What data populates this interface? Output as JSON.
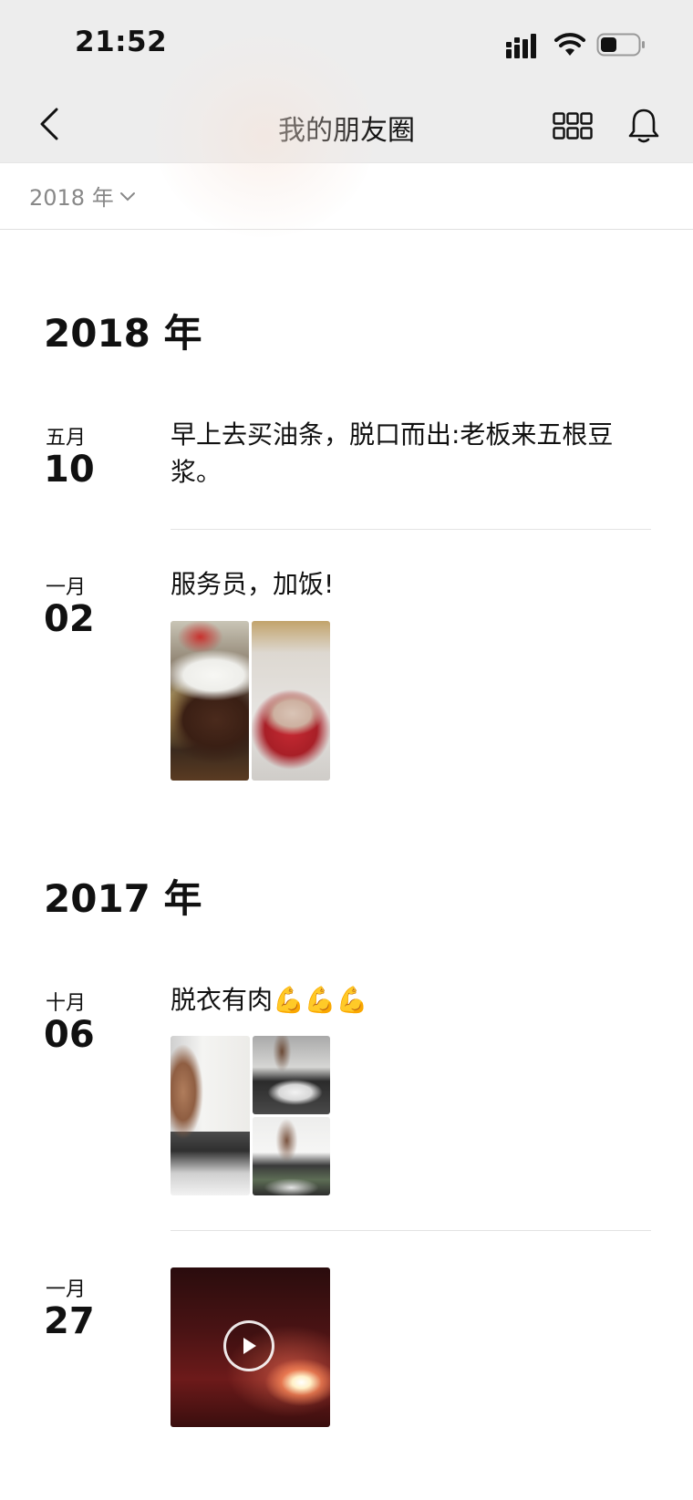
{
  "status_bar": {
    "time": "21:52",
    "icons": [
      "signal-icon",
      "wifi-icon",
      "battery-icon"
    ]
  },
  "nav": {
    "title": "我的朋友圈",
    "icons": [
      "back-icon",
      "grid-icon",
      "bell-icon"
    ]
  },
  "year_filter": {
    "label": "2018 年",
    "icon": "chevron-down-icon"
  },
  "timeline": [
    {
      "year": "2018 年",
      "posts": [
        {
          "month": "五月",
          "day": "10",
          "text": "早上去买油条，脱口而出:老板来五根豆浆。",
          "media": "none"
        },
        {
          "month": "一月",
          "day": "02",
          "text": "服务员，加饭!",
          "media": "2 photos"
        }
      ]
    },
    {
      "year": "2017 年",
      "posts": [
        {
          "month": "十月",
          "day": "06",
          "text": "脱衣有肉",
          "emoji": "💪💪💪",
          "media": "3 photos"
        },
        {
          "month": "一月",
          "day": "27",
          "text": "",
          "media": "video"
        }
      ]
    }
  ],
  "colors": {
    "header_bg": "#ededed",
    "text_primary": "#111111",
    "text_secondary": "#888888",
    "divider": "#e3e3e3",
    "emoji_accent": "#f0b428"
  }
}
